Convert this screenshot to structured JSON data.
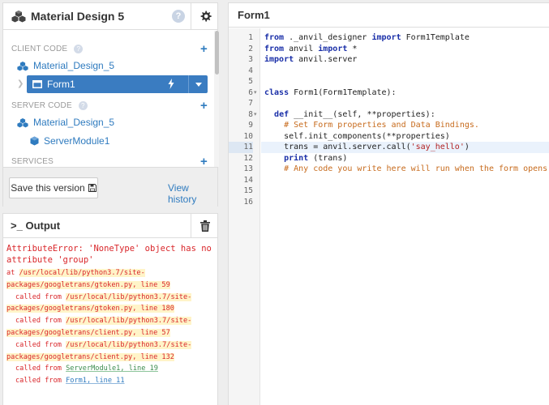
{
  "app": {
    "title": "Material Design 5",
    "help_glyph": "?",
    "gear_icon": "gear-icon",
    "logo_icon": "anvil-cubes-icon"
  },
  "tree": {
    "client_section": "CLIENT CODE",
    "server_section": "SERVER CODE",
    "services_section": "SERVICES",
    "plus_glyph": "+",
    "client_package": "Material_Design_5",
    "form_item": "Form1",
    "server_package": "Material_Design_5",
    "server_module": "ServerModule1"
  },
  "footer": {
    "save_label": "Save this version",
    "history_label": "View history"
  },
  "output": {
    "prompt_glyph": ">_",
    "title": "Output",
    "error": "AttributeError: 'NoneType' object has no attribute 'group'",
    "traceback": [
      {
        "prefix": "at ",
        "text": "/usr/local/lib/python3.7/site-",
        "style": "hl"
      },
      {
        "prefix": "",
        "text": "packages/googletrans/gtoken.py, line 59",
        "style": "hl"
      },
      {
        "prefix": "called from ",
        "text": "/usr/local/lib/python3.7/site-",
        "style": "hl"
      },
      {
        "prefix": "",
        "text": "packages/googletrans/gtoken.py, line 180",
        "style": "hl"
      },
      {
        "prefix": "called from ",
        "text": "/usr/local/lib/python3.7/site-",
        "style": "hl"
      },
      {
        "prefix": "",
        "text": "packages/googletrans/client.py, line 57",
        "style": "hl"
      },
      {
        "prefix": "called from ",
        "text": "/usr/local/lib/python3.7/site-",
        "style": "hl"
      },
      {
        "prefix": "",
        "text": "packages/googletrans/client.py, line 132",
        "style": "hl"
      },
      {
        "prefix": "called from ",
        "text": "ServerModule1, line 19",
        "style": "link-green"
      },
      {
        "prefix": "called from ",
        "text": "Form1, line 11",
        "style": "link"
      }
    ]
  },
  "editor": {
    "title": "Form1",
    "active_line": 11,
    "lines": [
      [
        [
          "k",
          "from"
        ],
        [
          "t",
          " ._anvil_designer "
        ],
        [
          "k",
          "import"
        ],
        [
          "t",
          " Form1Template"
        ]
      ],
      [
        [
          "k",
          "from"
        ],
        [
          "t",
          " anvil "
        ],
        [
          "k",
          "import"
        ],
        [
          "t",
          " *"
        ]
      ],
      [
        [
          "k",
          "import"
        ],
        [
          "t",
          " anvil.server"
        ]
      ],
      [],
      [],
      [
        [
          "k",
          "class"
        ],
        [
          "t",
          " Form1(Form1Template):"
        ]
      ],
      [],
      [
        [
          "t",
          "  "
        ],
        [
          "k",
          "def"
        ],
        [
          "t",
          " __init__(self, **properties):"
        ]
      ],
      [
        [
          "c",
          "    # Set Form properties and Data Bindings."
        ]
      ],
      [
        [
          "t",
          "    self.init_components(**properties)"
        ]
      ],
      [
        [
          "t",
          "    trans = anvil.server.call("
        ],
        [
          "s",
          "'say_hello'"
        ],
        [
          "t",
          ")"
        ]
      ],
      [
        [
          "t",
          "    "
        ],
        [
          "k",
          "print"
        ],
        [
          "t",
          " (trans)"
        ]
      ],
      [
        [
          "c",
          "    # Any code you write here will run when the form opens."
        ]
      ],
      [],
      [],
      []
    ],
    "fold_lines": [
      6,
      8
    ]
  }
}
